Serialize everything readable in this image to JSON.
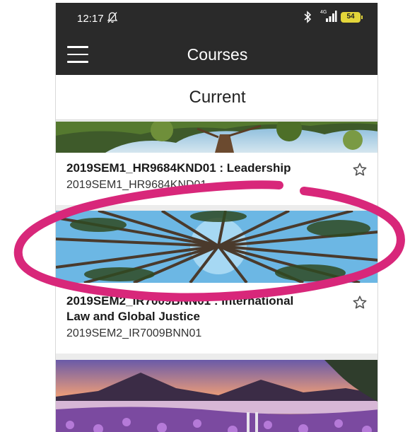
{
  "status_bar": {
    "time": "12:17",
    "network_label": "4G",
    "battery": "54",
    "icons": [
      "notifications-off-icon",
      "bluetooth-icon",
      "signal-icon",
      "battery-icon"
    ]
  },
  "app_bar": {
    "title": "Courses",
    "menu_icon": "hamburger-icon"
  },
  "section": {
    "title": "Current"
  },
  "courses": [
    {
      "title": "2019SEM1_HR9684KND01 : Leadership",
      "code": "2019SEM1_HR9684KND01",
      "image": "tree-canopy-horizon",
      "favorite_icon": "star-outline-icon"
    },
    {
      "title": "2019SEM2_IR7009BNN01 : International Law and Global Justice",
      "code": "2019SEM2_IR7009BNN01",
      "image": "pine-forest-looking-up",
      "favorite_icon": "star-outline-icon"
    },
    {
      "title": "",
      "code": "",
      "image": "lavender-lake-mountains-sunset",
      "favorite_icon": ""
    }
  ],
  "annotation": {
    "color": "#d8277a",
    "shape": "hand-drawn ellipse around second course image"
  },
  "colors": {
    "app_bar": "#2a2a2a",
    "background": "#ececec",
    "card": "#ffffff",
    "battery": "#e3d53a"
  }
}
